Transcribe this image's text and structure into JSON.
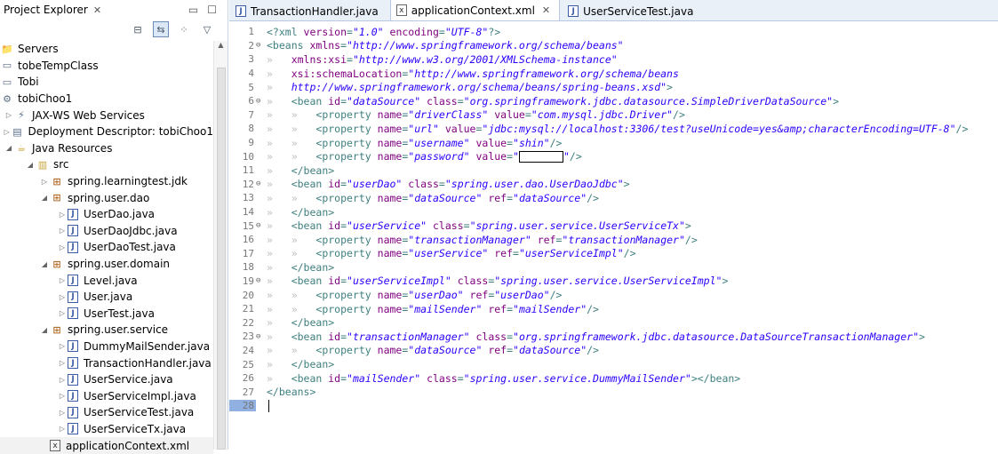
{
  "explorer": {
    "title": "Project Explorer",
    "tree": [
      {
        "depth": 0,
        "twisty": "",
        "icon": "folder-icon",
        "label": "Servers"
      },
      {
        "depth": 0,
        "twisty": "",
        "icon": "project-icon",
        "label": "tobeTempClass"
      },
      {
        "depth": 0,
        "twisty": "",
        "icon": "project-icon",
        "label": "Tobi"
      },
      {
        "depth": 0,
        "twisty": "",
        "icon": "web-project-icon",
        "label": "tobiChoo1"
      },
      {
        "depth": 1,
        "twisty": "▷",
        "icon": "web-services-icon",
        "label": "JAX-WS Web Services"
      },
      {
        "depth": 1,
        "twisty": "▷",
        "icon": "deployment-descriptor-icon",
        "label": "Deployment Descriptor: tobiChoo1"
      },
      {
        "depth": 1,
        "twisty": "◢",
        "icon": "java-resources-icon",
        "label": "Java Resources"
      },
      {
        "depth": 2,
        "twisty": "◢",
        "icon": "source-folder-icon",
        "label": "src"
      },
      {
        "depth": 3,
        "twisty": "▷",
        "icon": "package-icon",
        "label": "spring.learningtest.jdk"
      },
      {
        "depth": 3,
        "twisty": "◢",
        "icon": "package-icon",
        "label": "spring.user.dao"
      },
      {
        "depth": 4,
        "twisty": "▷",
        "icon": "java-file-icon",
        "label": "UserDao.java"
      },
      {
        "depth": 4,
        "twisty": "▷",
        "icon": "java-file-icon",
        "label": "UserDaoJdbc.java"
      },
      {
        "depth": 4,
        "twisty": "▷",
        "icon": "java-file-icon",
        "label": "UserDaoTest.java"
      },
      {
        "depth": 3,
        "twisty": "◢",
        "icon": "package-icon",
        "label": "spring.user.domain"
      },
      {
        "depth": 4,
        "twisty": "▷",
        "icon": "java-file-icon",
        "label": "Level.java"
      },
      {
        "depth": 4,
        "twisty": "▷",
        "icon": "java-file-icon",
        "label": "User.java"
      },
      {
        "depth": 4,
        "twisty": "▷",
        "icon": "java-file-icon",
        "label": "UserTest.java"
      },
      {
        "depth": 3,
        "twisty": "◢",
        "icon": "package-icon",
        "label": "spring.user.service"
      },
      {
        "depth": 4,
        "twisty": "▷",
        "icon": "java-file-icon",
        "label": "DummyMailSender.java"
      },
      {
        "depth": 4,
        "twisty": "▷",
        "icon": "java-file-icon",
        "label": "TransactionHandler.java"
      },
      {
        "depth": 4,
        "twisty": "▷",
        "icon": "java-file-icon",
        "label": "UserService.java"
      },
      {
        "depth": 4,
        "twisty": "▷",
        "icon": "java-file-icon",
        "label": "UserServiceImpl.java"
      },
      {
        "depth": 4,
        "twisty": "▷",
        "icon": "java-file-icon",
        "label": "UserServiceTest.java"
      },
      {
        "depth": 4,
        "twisty": "▷",
        "icon": "java-file-icon",
        "label": "UserServiceTx.java"
      },
      {
        "depth": 3,
        "twisty": "",
        "icon": "xml-file-icon",
        "label": "applicationContext.xml"
      }
    ]
  },
  "tabs": [
    {
      "label": "TransactionHandler.java",
      "icon": "java-file-icon",
      "active": false
    },
    {
      "label": "applicationContext.xml",
      "icon": "xml-file-icon",
      "active": true
    },
    {
      "label": "UserServiceTest.java",
      "icon": "java-file-icon",
      "active": false
    }
  ],
  "editor": {
    "lines": [
      {
        "n": "1",
        "fold": "",
        "indent": 0,
        "parts": [
          [
            "t",
            "<?xml "
          ],
          [
            "a",
            "version"
          ],
          [
            "t",
            "="
          ],
          [
            "v",
            "\"1.0\""
          ],
          [
            "t",
            " "
          ],
          [
            "a",
            "encoding"
          ],
          [
            "t",
            "="
          ],
          [
            "v",
            "\"UTF-8\""
          ],
          [
            "t",
            "?>"
          ]
        ]
      },
      {
        "n": "2",
        "fold": "⊖",
        "indent": 0,
        "parts": [
          [
            "t",
            "<beans "
          ],
          [
            "a",
            "xmlns"
          ],
          [
            "t",
            "="
          ],
          [
            "v",
            "\"http://www.springframework.org/schema/beans\""
          ]
        ]
      },
      {
        "n": "3",
        "fold": "",
        "indent": 1,
        "parts": [
          [
            "a",
            "xmlns:xsi"
          ],
          [
            "t",
            "="
          ],
          [
            "v",
            "\"http://www.w3.org/2001/XMLSchema-instance\""
          ]
        ]
      },
      {
        "n": "4",
        "fold": "",
        "indent": 1,
        "parts": [
          [
            "a",
            "xsi:schemaLocation"
          ],
          [
            "t",
            "="
          ],
          [
            "v",
            "\"http://www.springframework.org/schema/beans"
          ]
        ]
      },
      {
        "n": "5",
        "fold": "",
        "indent": 1,
        "parts": [
          [
            "v",
            "http://www.springframework.org/schema/beans/spring-beans.xsd\""
          ],
          [
            "t",
            ">"
          ]
        ]
      },
      {
        "n": "6",
        "fold": "⊖",
        "indent": 1,
        "parts": [
          [
            "t",
            "<bean "
          ],
          [
            "a",
            "id"
          ],
          [
            "t",
            "="
          ],
          [
            "v",
            "\"dataSource\""
          ],
          [
            "t",
            " "
          ],
          [
            "a",
            "class"
          ],
          [
            "t",
            "="
          ],
          [
            "v",
            "\"org.springframework.jdbc.datasource.SimpleDriverDataSource\""
          ],
          [
            "t",
            ">"
          ]
        ]
      },
      {
        "n": "7",
        "fold": "",
        "indent": 2,
        "parts": [
          [
            "t",
            "<property "
          ],
          [
            "a",
            "name"
          ],
          [
            "t",
            "="
          ],
          [
            "v",
            "\"driverClass\""
          ],
          [
            "t",
            " "
          ],
          [
            "a",
            "value"
          ],
          [
            "t",
            "="
          ],
          [
            "v",
            "\"com.mysql.jdbc.Driver\""
          ],
          [
            "t",
            "/>"
          ]
        ]
      },
      {
        "n": "8",
        "fold": "",
        "indent": 2,
        "parts": [
          [
            "t",
            "<property "
          ],
          [
            "a",
            "name"
          ],
          [
            "t",
            "="
          ],
          [
            "v",
            "\"url\""
          ],
          [
            "t",
            " "
          ],
          [
            "a",
            "value"
          ],
          [
            "t",
            "="
          ],
          [
            "v",
            "\"jdbc:mysql://localhost:3306/test?useUnicode=yes&amp;characterEncoding=UTF-8\""
          ],
          [
            "t",
            "/>"
          ]
        ]
      },
      {
        "n": "9",
        "fold": "",
        "indent": 2,
        "parts": [
          [
            "t",
            "<property "
          ],
          [
            "a",
            "name"
          ],
          [
            "t",
            "="
          ],
          [
            "v",
            "\"username\""
          ],
          [
            "t",
            " "
          ],
          [
            "a",
            "value"
          ],
          [
            "t",
            "="
          ],
          [
            "v",
            "\"shin\""
          ],
          [
            "t",
            "/>"
          ]
        ]
      },
      {
        "n": "10",
        "fold": "",
        "indent": 2,
        "parts": [
          [
            "t",
            "<property "
          ],
          [
            "a",
            "name"
          ],
          [
            "t",
            "="
          ],
          [
            "v",
            "\"password\""
          ],
          [
            "t",
            " "
          ],
          [
            "a",
            "value"
          ],
          [
            "t",
            "="
          ],
          [
            "v",
            "\""
          ],
          [
            "r",
            ""
          ],
          [
            "v",
            "\""
          ],
          [
            "t",
            "/>"
          ]
        ]
      },
      {
        "n": "11",
        "fold": "",
        "indent": 1,
        "parts": [
          [
            "t",
            "</bean>"
          ]
        ]
      },
      {
        "n": "12",
        "fold": "⊖",
        "indent": 1,
        "parts": [
          [
            "t",
            "<bean "
          ],
          [
            "a",
            "id"
          ],
          [
            "t",
            "="
          ],
          [
            "v",
            "\"userDao\""
          ],
          [
            "t",
            " "
          ],
          [
            "a",
            "class"
          ],
          [
            "t",
            "="
          ],
          [
            "v",
            "\"spring.user.dao.UserDaoJdbc\""
          ],
          [
            "t",
            ">"
          ]
        ]
      },
      {
        "n": "13",
        "fold": "",
        "indent": 2,
        "parts": [
          [
            "t",
            "<property "
          ],
          [
            "a",
            "name"
          ],
          [
            "t",
            "="
          ],
          [
            "v",
            "\"dataSource\""
          ],
          [
            "t",
            " "
          ],
          [
            "a",
            "ref"
          ],
          [
            "t",
            "="
          ],
          [
            "v",
            "\"dataSource\""
          ],
          [
            "t",
            "/>"
          ]
        ]
      },
      {
        "n": "14",
        "fold": "",
        "indent": 1,
        "parts": [
          [
            "t",
            "</bean>"
          ]
        ]
      },
      {
        "n": "15",
        "fold": "⊖",
        "indent": 1,
        "parts": [
          [
            "t",
            "<bean "
          ],
          [
            "a",
            "id"
          ],
          [
            "t",
            "="
          ],
          [
            "v",
            "\"userService\""
          ],
          [
            "t",
            " "
          ],
          [
            "a",
            "class"
          ],
          [
            "t",
            "="
          ],
          [
            "v",
            "\"spring.user.service.UserServiceTx\""
          ],
          [
            "t",
            ">"
          ]
        ]
      },
      {
        "n": "16",
        "fold": "",
        "indent": 2,
        "parts": [
          [
            "t",
            "<property "
          ],
          [
            "a",
            "name"
          ],
          [
            "t",
            "="
          ],
          [
            "v",
            "\"transactionManager\""
          ],
          [
            "t",
            " "
          ],
          [
            "a",
            "ref"
          ],
          [
            "t",
            "="
          ],
          [
            "v",
            "\"transactionManager\""
          ],
          [
            "t",
            "/>"
          ]
        ]
      },
      {
        "n": "17",
        "fold": "",
        "indent": 2,
        "parts": [
          [
            "t",
            "<property "
          ],
          [
            "a",
            "name"
          ],
          [
            "t",
            "="
          ],
          [
            "v",
            "\"userService\""
          ],
          [
            "t",
            " "
          ],
          [
            "a",
            "ref"
          ],
          [
            "t",
            "="
          ],
          [
            "v",
            "\"userServiceImpl\""
          ],
          [
            "t",
            "/>"
          ]
        ]
      },
      {
        "n": "18",
        "fold": "",
        "indent": 1,
        "parts": [
          [
            "t",
            "</bean>"
          ]
        ]
      },
      {
        "n": "19",
        "fold": "⊖",
        "indent": 1,
        "parts": [
          [
            "t",
            "<bean "
          ],
          [
            "a",
            "id"
          ],
          [
            "t",
            "="
          ],
          [
            "v",
            "\"userServiceImpl\""
          ],
          [
            "t",
            " "
          ],
          [
            "a",
            "class"
          ],
          [
            "t",
            "="
          ],
          [
            "v",
            "\"spring.user.service.UserServiceImpl\""
          ],
          [
            "t",
            ">"
          ]
        ]
      },
      {
        "n": "20",
        "fold": "",
        "indent": 2,
        "parts": [
          [
            "t",
            "<property "
          ],
          [
            "a",
            "name"
          ],
          [
            "t",
            "="
          ],
          [
            "v",
            "\"userDao\""
          ],
          [
            "t",
            " "
          ],
          [
            "a",
            "ref"
          ],
          [
            "t",
            "="
          ],
          [
            "v",
            "\"userDao\""
          ],
          [
            "t",
            "/>"
          ]
        ]
      },
      {
        "n": "21",
        "fold": "",
        "indent": 2,
        "parts": [
          [
            "t",
            "<property "
          ],
          [
            "a",
            "name"
          ],
          [
            "t",
            "="
          ],
          [
            "v",
            "\"mailSender\""
          ],
          [
            "t",
            " "
          ],
          [
            "a",
            "ref"
          ],
          [
            "t",
            "="
          ],
          [
            "v",
            "\"mailSender\""
          ],
          [
            "t",
            "/>"
          ]
        ]
      },
      {
        "n": "22",
        "fold": "",
        "indent": 1,
        "parts": [
          [
            "t",
            "</bean>"
          ]
        ]
      },
      {
        "n": "23",
        "fold": "⊖",
        "indent": 1,
        "parts": [
          [
            "t",
            "<bean "
          ],
          [
            "a",
            "id"
          ],
          [
            "t",
            "="
          ],
          [
            "v",
            "\"transactionManager\""
          ],
          [
            "t",
            " "
          ],
          [
            "a",
            "class"
          ],
          [
            "t",
            "="
          ],
          [
            "v",
            "\"org.springframework.jdbc.datasource.DataSourceTransactionManager\""
          ],
          [
            "t",
            ">"
          ]
        ]
      },
      {
        "n": "24",
        "fold": "",
        "indent": 2,
        "parts": [
          [
            "t",
            "<property "
          ],
          [
            "a",
            "name"
          ],
          [
            "t",
            "="
          ],
          [
            "v",
            "\"dataSource\""
          ],
          [
            "t",
            " "
          ],
          [
            "a",
            "ref"
          ],
          [
            "t",
            "="
          ],
          [
            "v",
            "\"dataSource\""
          ],
          [
            "t",
            "/>"
          ]
        ]
      },
      {
        "n": "25",
        "fold": "",
        "indent": 1,
        "parts": [
          [
            "t",
            "</bean>"
          ]
        ]
      },
      {
        "n": "26",
        "fold": "",
        "indent": 1,
        "parts": [
          [
            "t",
            "<bean "
          ],
          [
            "a",
            "id"
          ],
          [
            "t",
            "="
          ],
          [
            "v",
            "\"mailSender\""
          ],
          [
            "t",
            " "
          ],
          [
            "a",
            "class"
          ],
          [
            "t",
            "="
          ],
          [
            "v",
            "\"spring.user.service.DummyMailSender\""
          ],
          [
            "t",
            "></bean>"
          ]
        ]
      },
      {
        "n": "27",
        "fold": "",
        "indent": 0,
        "parts": [
          [
            "t",
            "</beans>"
          ]
        ]
      },
      {
        "n": "28",
        "fold": "",
        "indent": 0,
        "parts": [
          [
            "c",
            ""
          ]
        ]
      }
    ]
  },
  "colors": {
    "tag": "#3f7f7f",
    "attribute": "#7f007f",
    "value": "#2a00ff",
    "tab_bar": "#eaf0f8"
  }
}
